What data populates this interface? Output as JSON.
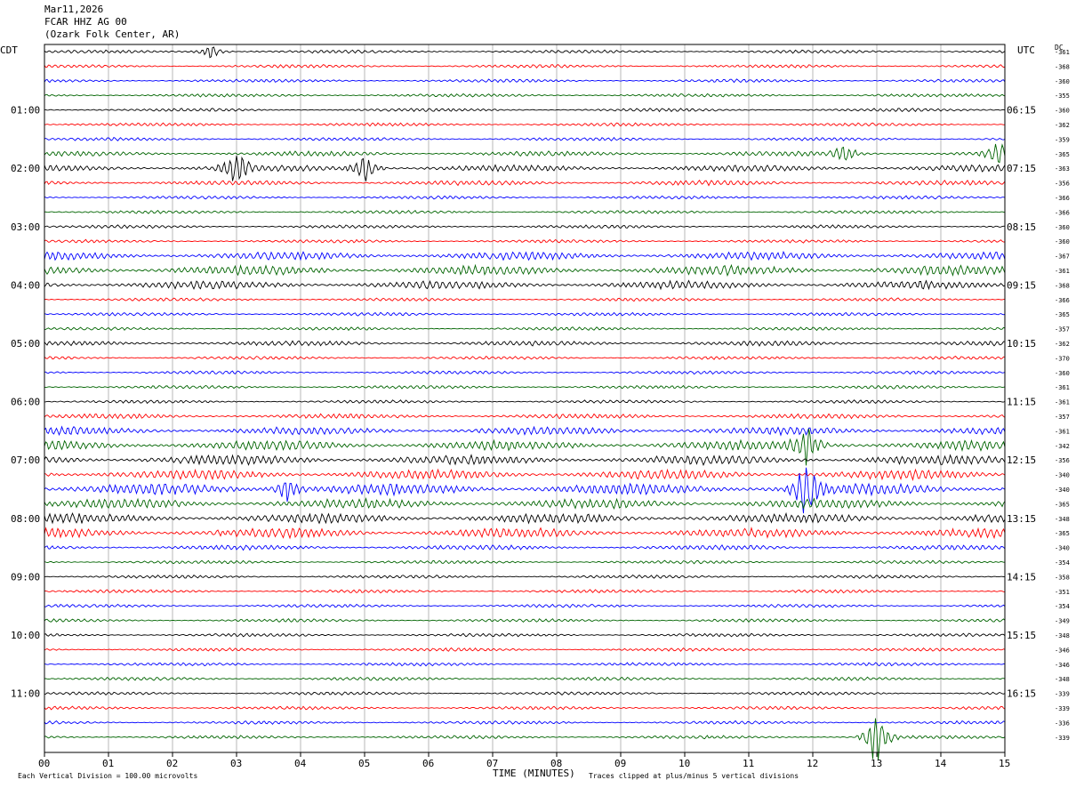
{
  "header": {
    "date": "Mar11,2026",
    "station": "FCAR HHZ AG 00",
    "location": "(Ozark Folk Center, AR)"
  },
  "left_tz": "CDT",
  "right_tz": "UTC",
  "dc_header": "DC",
  "left_hour_labels": [
    "01:00",
    "02:00",
    "03:00",
    "04:00",
    "05:00",
    "06:00",
    "07:00",
    "08:00",
    "09:00",
    "10:00",
    "11:00"
  ],
  "right_hour_labels": [
    "06:15",
    "07:15",
    "08:15",
    "09:15",
    "10:15",
    "11:15",
    "12:15",
    "13:15",
    "14:15",
    "15:15",
    "16:15"
  ],
  "minute_ticks": [
    "00",
    "01",
    "02",
    "03",
    "04",
    "05",
    "06",
    "07",
    "08",
    "09",
    "10",
    "11",
    "12",
    "13",
    "14",
    "15"
  ],
  "xlabel": "TIME (MINUTES)",
  "footer": {
    "scale_note": "Each Vertical Division =  100.00 microvolts",
    "clip_note": "Traces clipped at plus/minus 5 vertical divisions"
  },
  "trace_colors": [
    "#000000",
    "#ff0000",
    "#0000ff",
    "#006400"
  ],
  "dc_offsets": [
    "-361",
    "-368",
    "-360",
    "-355",
    "-360",
    "-362",
    "-359",
    "-365",
    "-363",
    "-356",
    "-366",
    "-366",
    "-360",
    "-360",
    "-367",
    "-361",
    "-368",
    "-366",
    "-365",
    "-357",
    "-362",
    "-370",
    "-360",
    "-361",
    "-361",
    "-357",
    "-361",
    "-342",
    "-356",
    "-340",
    "-340",
    "-365",
    "-348",
    "-365",
    "-340",
    "-354",
    "-358",
    "-351",
    "-354",
    "-349",
    "-348",
    "-346",
    "-346",
    "-348",
    "-339",
    "-339",
    "-336",
    "-339"
  ],
  "chart_data": {
    "type": "helicorder",
    "rows": 48,
    "minutes_per_row": 15,
    "x_range_minutes": [
      0,
      15
    ],
    "noise_levels": [
      2,
      2,
      2,
      2,
      2,
      2,
      2,
      3,
      4,
      3,
      2,
      2,
      2,
      2,
      5,
      6,
      5,
      2,
      2,
      2,
      3,
      2,
      2,
      2,
      2,
      3,
      5,
      6,
      6,
      6,
      7,
      6,
      6,
      6,
      3,
      2,
      2,
      2,
      2,
      2,
      2,
      2,
      2,
      2,
      2,
      2,
      2,
      2
    ],
    "events": [
      {
        "row": 0,
        "minute": 2.6,
        "amplitude": 10
      },
      {
        "row": 8,
        "minute": 3.0,
        "amplitude": 25
      },
      {
        "row": 8,
        "minute": 5.0,
        "amplitude": 22
      },
      {
        "row": 7,
        "minute": 12.5,
        "amplitude": 12
      },
      {
        "row": 7,
        "minute": 14.9,
        "amplitude": 14
      },
      {
        "row": 30,
        "minute": 11.9,
        "amplitude": 40
      },
      {
        "row": 30,
        "minute": 3.8,
        "amplitude": 18
      },
      {
        "row": 27,
        "minute": 11.9,
        "amplitude": 30
      },
      {
        "row": 47,
        "minute": 13.0,
        "amplitude": 45
      }
    ]
  }
}
